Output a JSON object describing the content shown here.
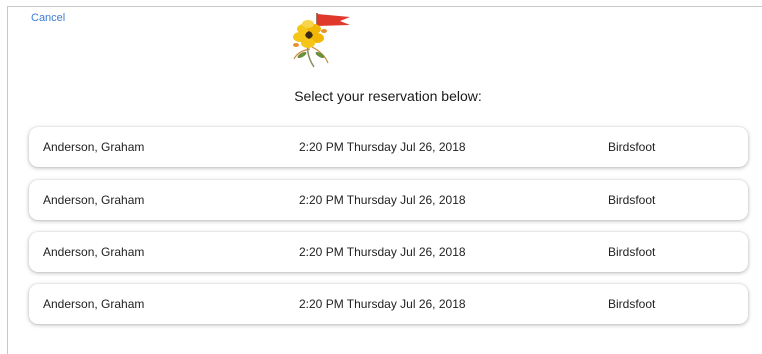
{
  "header": {
    "cancel_label": "Cancel",
    "logo": "flower-flag-logo"
  },
  "main": {
    "heading": "Select your reservation below:",
    "reservations": [
      {
        "name": "Anderson, Graham",
        "datetime": "2:20 PM Thursday Jul 26, 2018",
        "location": "Birdsfoot"
      },
      {
        "name": "Anderson, Graham",
        "datetime": "2:20 PM Thursday Jul 26, 2018",
        "location": "Birdsfoot"
      },
      {
        "name": "Anderson, Graham",
        "datetime": "2:20 PM Thursday Jul 26, 2018",
        "location": "Birdsfoot"
      },
      {
        "name": "Anderson, Graham",
        "datetime": "2:20 PM Thursday Jul 26, 2018",
        "location": "Birdsfoot"
      }
    ]
  },
  "colors": {
    "link": "#3b7dd8",
    "flag": "#e0392b",
    "petals": "#f5c518"
  }
}
